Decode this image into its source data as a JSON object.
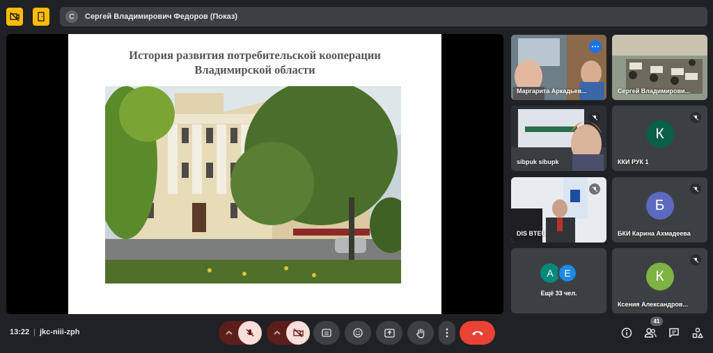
{
  "colors": {
    "background": "#202124",
    "accent_yellow": "#fbbc04",
    "end_call": "#ea4335",
    "muted_pink": "#f9dedc"
  },
  "top_bar": {
    "left_icons": [
      "no-camera-icon",
      "door-icon"
    ],
    "presenter_initial": "С",
    "presenter_label": "Сергей Владимирович Федоров (Показ)"
  },
  "slide": {
    "title_line1": "История развития потребительской кооперации",
    "title_line2": "Владимирской области",
    "photo": "photo of a three-storey building behind trees"
  },
  "participants": [
    {
      "name": "Маргарита Аркадьев...",
      "type": "video",
      "active": true,
      "more_menu": true
    },
    {
      "name": "Сергей Владимирови...",
      "type": "video"
    },
    {
      "name": "sibpuk sibupk",
      "type": "video",
      "muted": true
    },
    {
      "name": "ККИ РУК 1",
      "type": "avatar",
      "initial": "К",
      "avatar_color": "#0b5e47",
      "muted": true
    },
    {
      "name": "DIS BTEU",
      "type": "video",
      "muted": true
    },
    {
      "name": "БКИ Карина Ахмадеева",
      "type": "avatar",
      "initial": "Б",
      "avatar_color": "#5c6bc0",
      "muted": true
    },
    {
      "name": "Ещё 33 чел.",
      "type": "group",
      "initials": [
        "А",
        "Е"
      ],
      "avatar_colors": [
        "#00897b",
        "#1e88e5"
      ]
    },
    {
      "name": "Ксения Александров...",
      "type": "avatar",
      "initial": "К",
      "avatar_color": "#7cb342",
      "muted": true
    }
  ],
  "bottom_bar": {
    "time": "13:22",
    "meeting_code": "jkc-niii-zph",
    "controls": [
      "mic-options",
      "mic-off",
      "camera-options",
      "camera-off",
      "captions",
      "emoji",
      "present",
      "raise-hand",
      "more-options",
      "leave-call"
    ],
    "right_icons": [
      "info-icon",
      "people-icon",
      "chat-icon",
      "activities-icon"
    ],
    "people_count": "41"
  }
}
